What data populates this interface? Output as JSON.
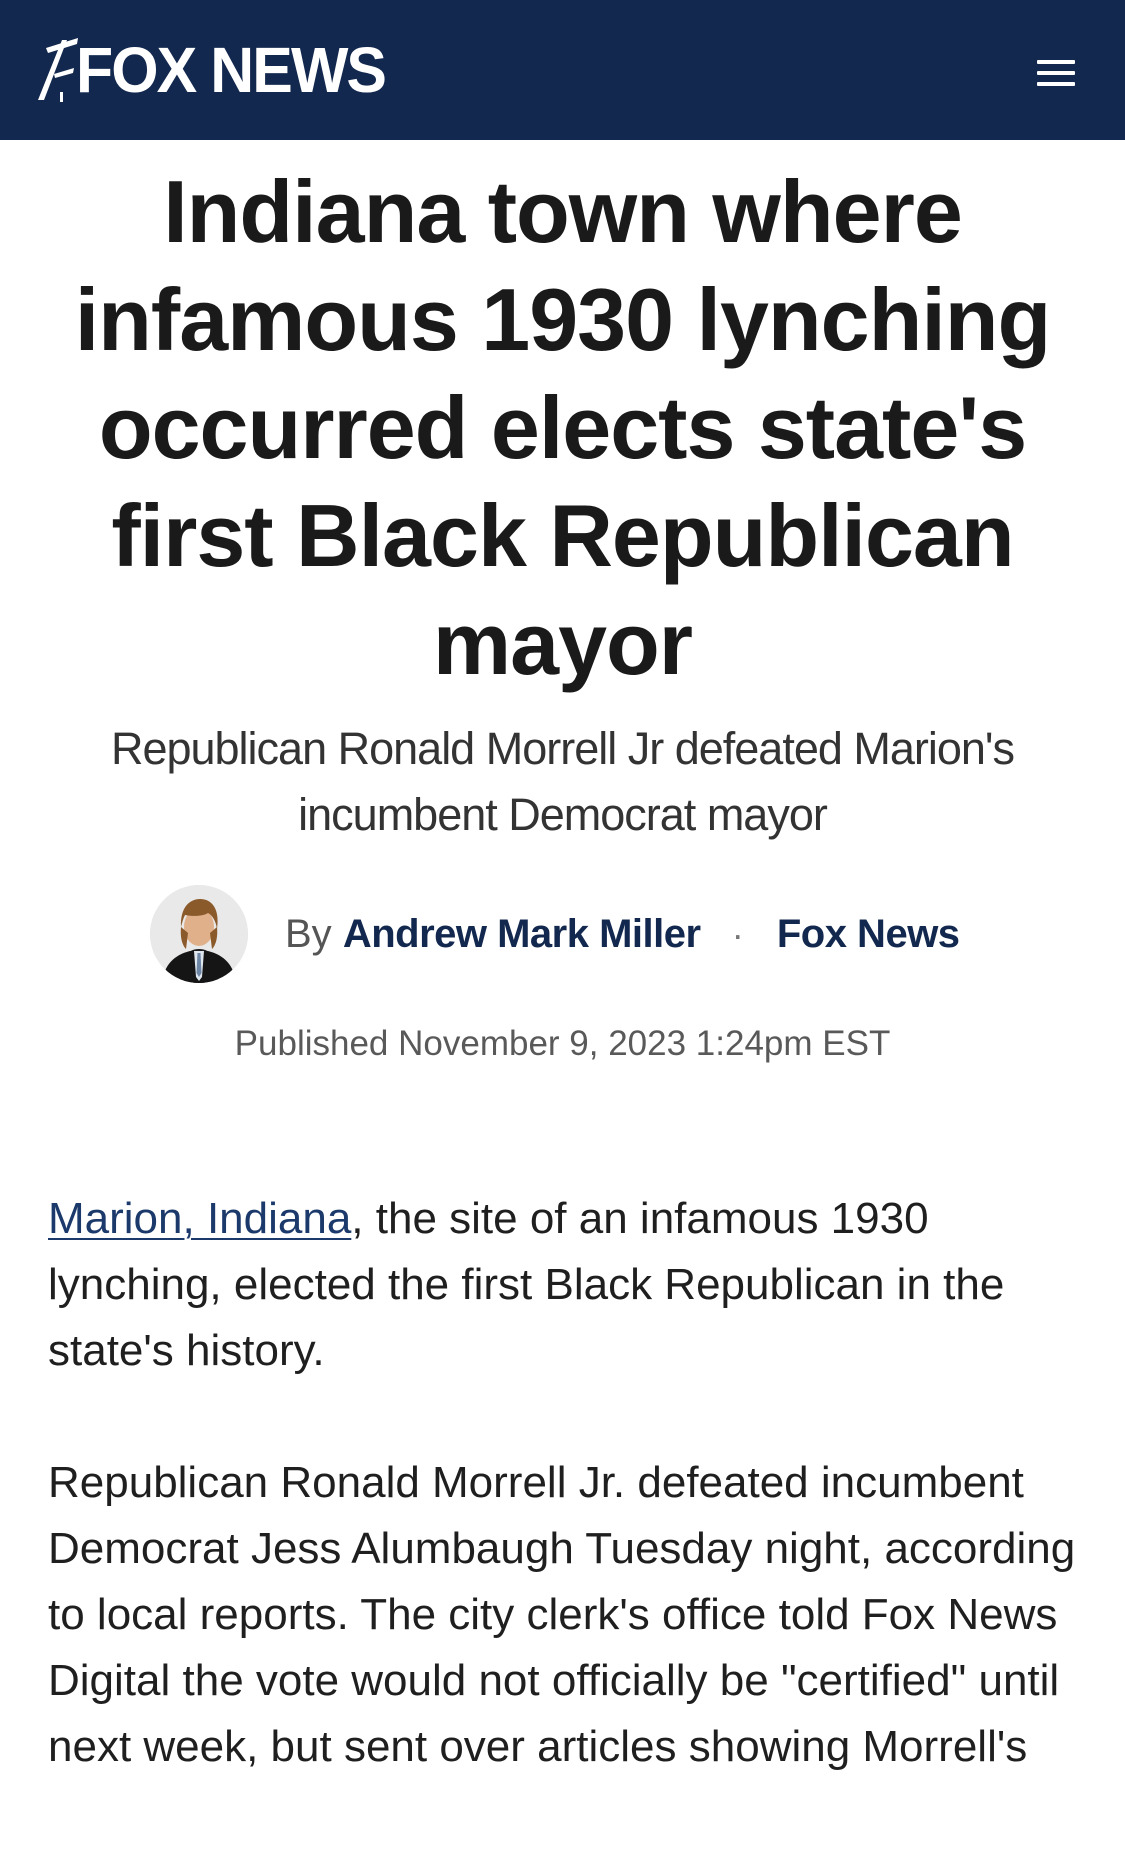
{
  "header": {
    "logo_text": "FOX NEWS",
    "menu_icon": "hamburger-menu-icon",
    "background_color": "#13284e"
  },
  "article": {
    "headline": "Indiana town where infamous 1930 lynching occurred elects state's first Black Republican mayor",
    "subheadline": "Republican Ronald Morrell Jr defeated Marion's incumbent Democrat mayor",
    "byline": {
      "by_label": "By",
      "author": "Andrew Mark Miller",
      "separator": "·",
      "source": "Fox News"
    },
    "published": "Published November 9, 2023 1:24pm EST",
    "paragraph1": {
      "link_text": "Marion, Indiana",
      "text": ", the site of an infamous 1930 lynching, elected the first Black Republican in the state's history."
    },
    "paragraph2": "Republican Ronald Morrell Jr. defeated incumbent Democrat Jess Alumbaugh Tuesday night, according to local reports. The city clerk's office told Fox News Digital the vote would not officially be \"certified\" until next week, but sent over articles showing Morrell's"
  },
  "colors": {
    "brand_navy": "#13284e",
    "link": "#1b3a6b",
    "text": "#1a1a1a"
  }
}
